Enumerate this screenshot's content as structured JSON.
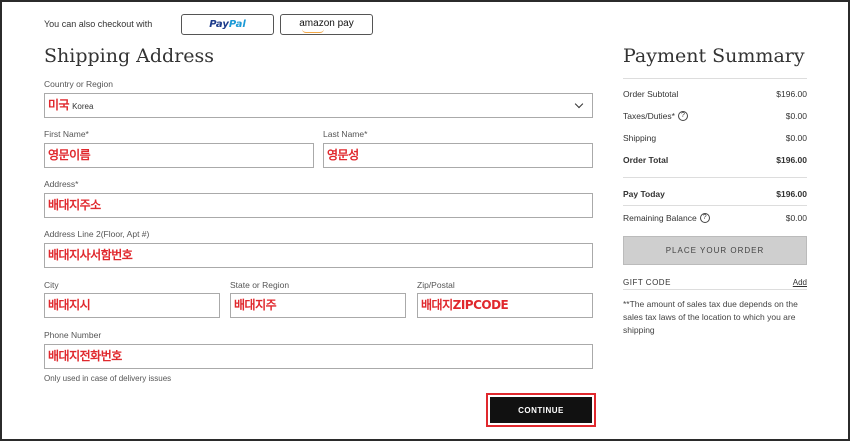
{
  "express": {
    "label": "You can also checkout with",
    "paypal_a": "Pay",
    "paypal_b": "Pal",
    "amazon": "amazon pay"
  },
  "shipping": {
    "title": "Shipping Address",
    "country_label": "Country or Region",
    "country_value": "미국",
    "country_sub": "Korea",
    "first_name_label": "First Name*",
    "first_name_value": "영문이름",
    "last_name_label": "Last Name*",
    "last_name_value": "영문성",
    "address_label": "Address*",
    "address_value": "배대지주소",
    "address2_label": "Address Line 2(Floor, Apt #)",
    "address2_value": "배대지사서함번호",
    "city_label": "City",
    "city_value": "배대지시",
    "state_label": "State or Region",
    "state_value": "배대지주",
    "zip_label": "Zip/Postal",
    "zip_value": "배대지ZIPCODE",
    "phone_label": "Phone Number",
    "phone_value": "배대지전화번호",
    "phone_note": "Only used in case of delivery issues",
    "continue_label": "CONTINUE"
  },
  "summary": {
    "title": "Payment Summary",
    "subtotal_label": "Order Subtotal",
    "subtotal_value": "$196.00",
    "taxes_label": "Taxes/Duties*",
    "taxes_value": "$0.00",
    "shipping_label": "Shipping",
    "shipping_value": "$0.00",
    "total_label": "Order Total",
    "total_value": "$196.00",
    "pay_today_label": "Pay Today",
    "pay_today_value": "$196.00",
    "remaining_label": "Remaining Balance",
    "remaining_value": "$0.00",
    "place_order_label": "PLACE YOUR ORDER",
    "gift_code_label": "GIFT CODE",
    "gift_add_label": "Add",
    "tax_note": "**The amount of sales tax due depends on the sales tax laws of the location to which you are shipping",
    "info_glyph": "?"
  },
  "colors": {
    "annotation_red": "#e0282d",
    "button_dark": "#111111",
    "button_disabled": "#cfcfcf"
  }
}
